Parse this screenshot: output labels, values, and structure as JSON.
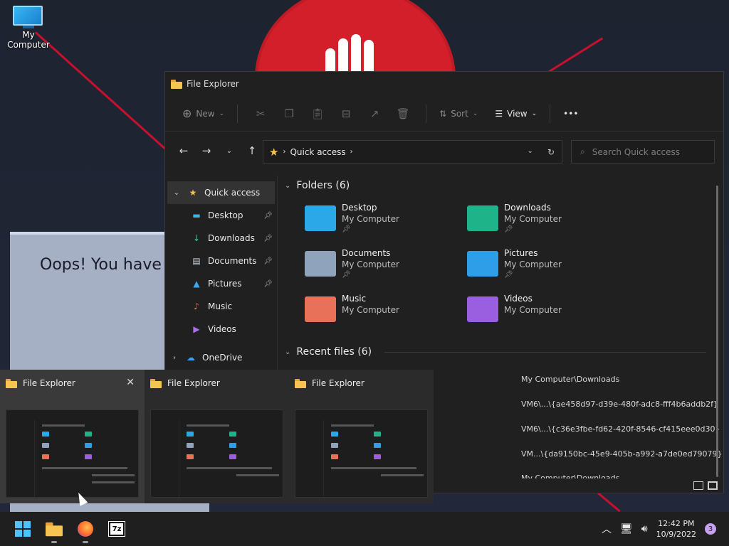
{
  "desktop": {
    "icon_label": "My Computer",
    "ransom_text": "Oops! You have"
  },
  "window": {
    "title": "File Explorer",
    "toolbar": {
      "new_label": "New",
      "sort_label": "Sort",
      "view_label": "View",
      "more_label": "•••"
    },
    "address": {
      "location": "Quick access"
    },
    "search": {
      "placeholder": "Search Quick access"
    },
    "sidebar": [
      {
        "label": "Quick access",
        "icon": "star-icon",
        "pinned": false
      },
      {
        "label": "Desktop",
        "icon": "desktop-icon",
        "pinned": true
      },
      {
        "label": "Downloads",
        "icon": "download-icon",
        "pinned": true
      },
      {
        "label": "Documents",
        "icon": "document-icon",
        "pinned": true
      },
      {
        "label": "Pictures",
        "icon": "pictures-icon",
        "pinned": true
      },
      {
        "label": "Music",
        "icon": "music-icon",
        "pinned": false
      },
      {
        "label": "Videos",
        "icon": "videos-icon",
        "pinned": false
      },
      {
        "label": "OneDrive",
        "icon": "cloud-icon",
        "pinned": false
      }
    ],
    "folders_header": "Folders (6)",
    "folders": [
      {
        "name": "Desktop",
        "location": "My Computer",
        "color": "#2ba8e8"
      },
      {
        "name": "Downloads",
        "location": "My Computer",
        "color": "#1fb38a"
      },
      {
        "name": "Documents",
        "location": "My Computer",
        "color": "#8fa3bd"
      },
      {
        "name": "Pictures",
        "location": "My Computer",
        "color": "#2e9ee8"
      },
      {
        "name": "Music",
        "location": "My Computer",
        "color": "#e8715a"
      },
      {
        "name": "Videos",
        "location": "My Computer",
        "color": "#9a5ee0"
      }
    ],
    "recent_header": "Recent files (6)",
    "recent_paths": [
      "My Computer\\Downloads",
      "VM6\\...\\{ae458d97-d39e-480f-adc8-fff4b6addb2f}",
      "VM6\\...\\{c36e3fbe-fd62-420f-8546-cf415eee0d30}",
      "VM...\\{da9150bc-45e9-405b-a992-a7de0ed79079}",
      "My Computer\\Downloads"
    ]
  },
  "thumbnails": [
    {
      "title": "File Explorer"
    },
    {
      "title": "File Explorer"
    },
    {
      "title": "File Explorer"
    }
  ],
  "tray": {
    "time": "12:42 PM",
    "date": "10/9/2022",
    "notifications": "3"
  },
  "taskbar": {
    "sevenzip_label": "7z"
  }
}
